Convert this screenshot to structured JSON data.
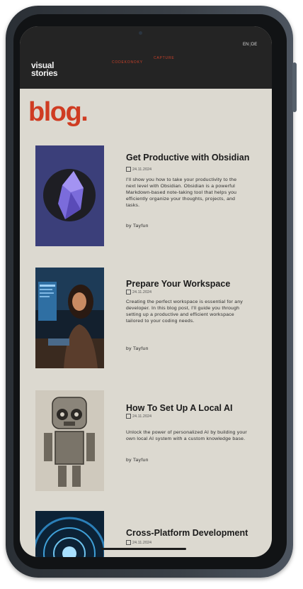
{
  "header": {
    "logo": "visual\nstories",
    "logo_line1": "visual",
    "logo_line2": "stories",
    "nav": [
      "CODEKONOKY",
      "CAPTURE"
    ],
    "lang": {
      "en": "EN",
      "sep": "|",
      "de": "DE"
    }
  },
  "page": {
    "title": "blog."
  },
  "posts": [
    {
      "title": "Get Productive with Obsidian",
      "date": "24.11.2024",
      "description": "I'll show you how to take your productivity to the next level with Obsidian. Obsidian is a powerful Markdown-based note-taking tool that helps you efficiently organize your thoughts, projects, and tasks.",
      "author": "by Tayfun",
      "image": "obsidian-logo"
    },
    {
      "title": "Prepare Your Workspace",
      "date": "24.11.2024",
      "description": "Creating the perfect workspace is essential for any developer. In this blog post, I'll guide you through setting up a productive and efficient workspace tailored to your coding needs.",
      "author": "by Tayfun",
      "image": "developer-at-desk-photo"
    },
    {
      "title": "How To Set Up A Local AI",
      "date": "24.11.2024",
      "description": "Unlock the power of personalized AI by building your own local AI system with a custom knowledge base.",
      "author": "by Tayfun",
      "image": "robot-sketch"
    },
    {
      "title": "Cross-Platform Development",
      "date": "24.11.2024",
      "image": "blue-tunnel-photo"
    }
  ],
  "colors": {
    "accent": "#cf3c22",
    "header_bg": "#242424",
    "page_bg": "#dcd9d0"
  }
}
